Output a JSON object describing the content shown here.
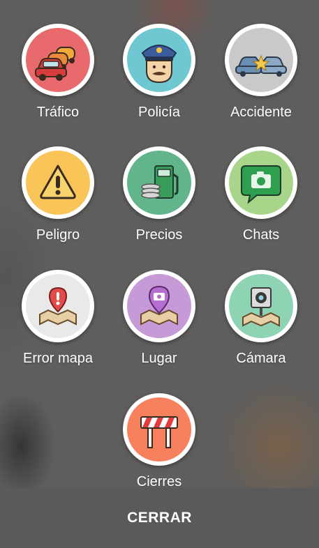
{
  "report_menu": {
    "items": [
      {
        "label": "Tráfico",
        "color": "#e96a6d",
        "icon": "traffic-jam-icon"
      },
      {
        "label": "Policía",
        "color": "#6fc7d1",
        "icon": "police-icon"
      },
      {
        "label": "Accidente",
        "color": "#c9c9c9",
        "icon": "accident-icon"
      },
      {
        "label": "Peligro",
        "color": "#f9c458",
        "icon": "hazard-icon"
      },
      {
        "label": "Precios",
        "color": "#62b48b",
        "icon": "gas-price-icon"
      },
      {
        "label": "Chats",
        "color": "#a9d58b",
        "icon": "chat-camera-icon"
      },
      {
        "label": "Error mapa",
        "color": "#e9e9e9",
        "icon": "map-error-icon"
      },
      {
        "label": "Lugar",
        "color": "#c69ad6",
        "icon": "place-icon"
      },
      {
        "label": "Cámara",
        "color": "#8fd3b5",
        "icon": "traffic-camera-icon"
      },
      {
        "label": "Cierres",
        "color": "#f7815c",
        "icon": "road-closure-icon"
      }
    ]
  },
  "footer": {
    "close_label": "CERRAR"
  }
}
